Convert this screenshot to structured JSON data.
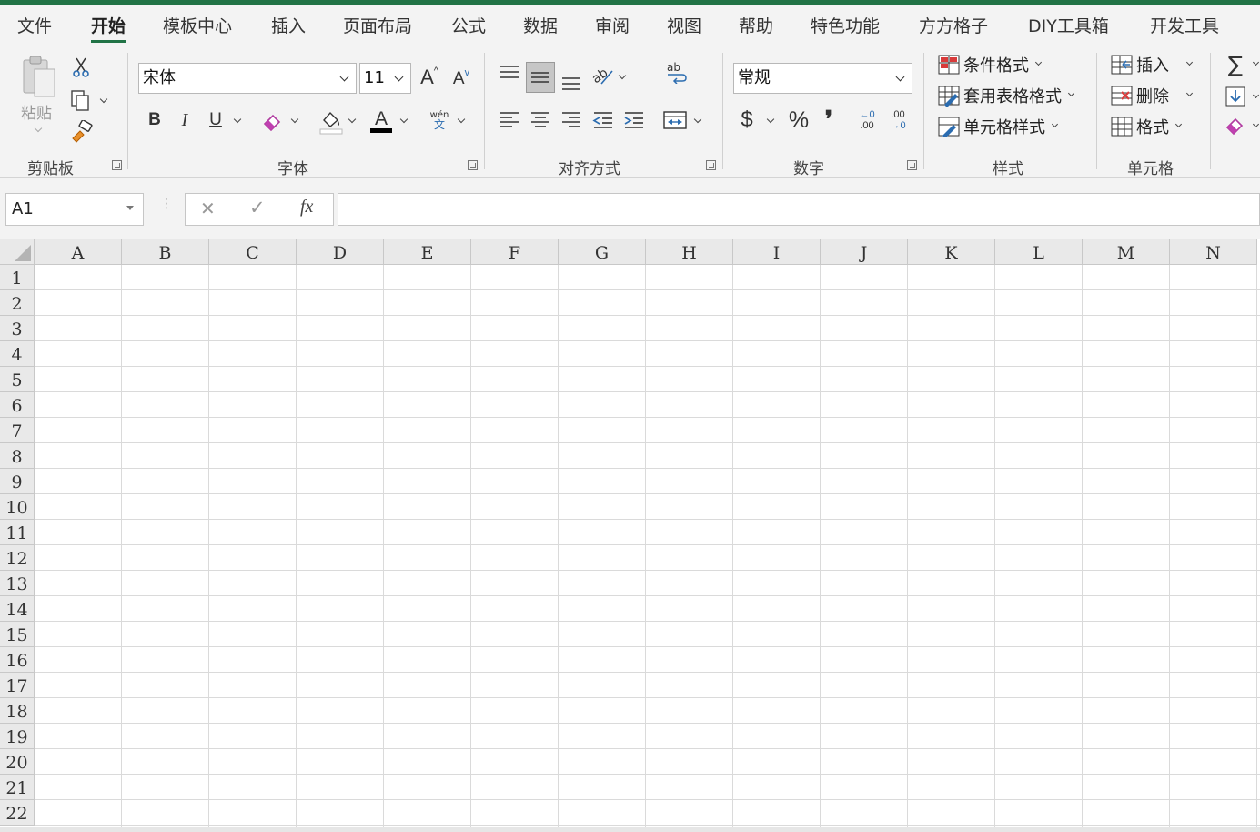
{
  "menu": {
    "tabs": [
      "文件",
      "开始",
      "模板中心",
      "插入",
      "页面布局",
      "公式",
      "数据",
      "审阅",
      "视图",
      "帮助",
      "特色功能",
      "方方格子",
      "DIY工具箱",
      "开发工具"
    ],
    "active": "开始"
  },
  "ribbon": {
    "clipboard": {
      "paste_label": "粘贴",
      "group_label": "剪贴板"
    },
    "font": {
      "font_name": "宋体",
      "font_size": "11",
      "bold": "B",
      "italic": "I",
      "underline": "U",
      "phonetic_top": "wén",
      "phonetic_bottom": "文",
      "group_label": "字体"
    },
    "alignment": {
      "group_label": "对齐方式"
    },
    "number": {
      "format": "常规",
      "currency": "$",
      "percent": "%",
      "comma": "❜",
      "inc_decimal_top": "←0",
      "inc_decimal_bottom": ".00",
      "dec_decimal_top": ".00",
      "dec_decimal_bottom": "→0",
      "group_label": "数字"
    },
    "styles": {
      "conditional": "条件格式",
      "table": "套用表格格式",
      "cell": "单元格样式",
      "group_label": "样式"
    },
    "cells": {
      "insert": "插入",
      "delete": "删除",
      "format": "格式",
      "group_label": "单元格"
    },
    "editing": {
      "sum_symbol": "∑"
    }
  },
  "formula_bar": {
    "name_box": "A1",
    "cancel": "✕",
    "enter": "✓",
    "fx": "fx",
    "value": ""
  },
  "grid": {
    "columns": [
      "A",
      "B",
      "C",
      "D",
      "E",
      "F",
      "G",
      "H",
      "I",
      "J",
      "K",
      "L",
      "M",
      "N"
    ],
    "rows": [
      "1",
      "2",
      "3",
      "4",
      "5",
      "6",
      "7",
      "8",
      "9",
      "10",
      "11",
      "12",
      "13",
      "14",
      "15",
      "16",
      "17",
      "18",
      "19",
      "20",
      "21",
      "22"
    ]
  },
  "colors": {
    "accent": "#217346",
    "ribbon_bg": "#f3f3f3",
    "gridline": "#dadada",
    "header_bg": "#e9e9e9"
  }
}
